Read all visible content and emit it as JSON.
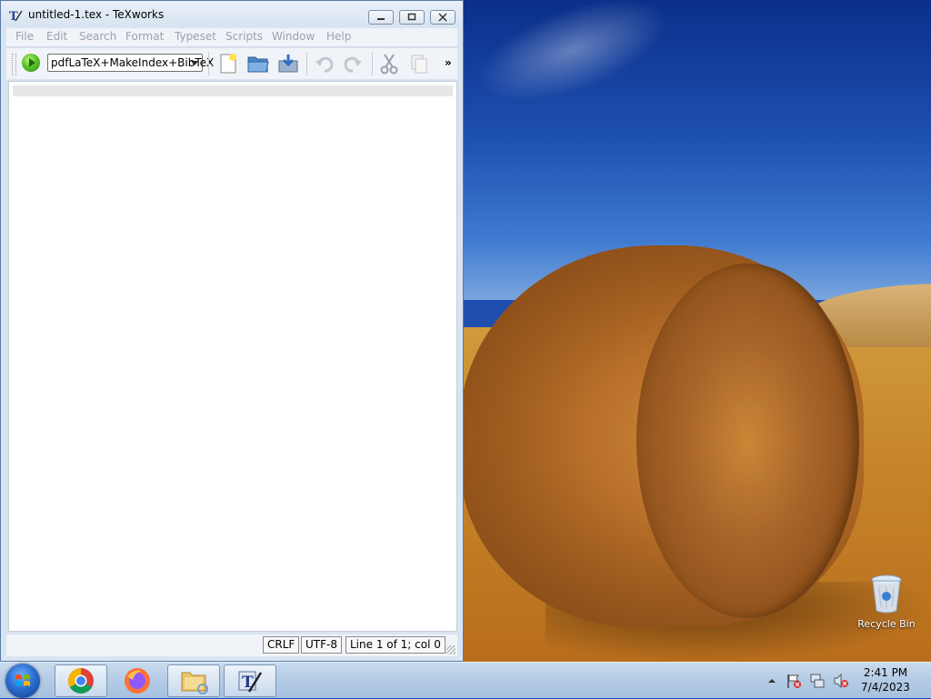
{
  "window": {
    "title": "untitled-1.tex - TeXworks",
    "controls": {
      "minimize": "minimize",
      "maximize": "maximize",
      "close": "close"
    }
  },
  "menubar": {
    "items": [
      "File",
      "Edit",
      "Search",
      "Format",
      "Typeset",
      "Scripts",
      "Window",
      "Help"
    ]
  },
  "toolbar": {
    "engine_value": "pdfLaTeX+MakeIndex+BibTeX",
    "more_label": "»",
    "icons": [
      "typeset-icon",
      "new-document-icon",
      "open-folder-icon",
      "save-icon",
      "undo-icon",
      "redo-icon",
      "cut-icon",
      "copy-icon"
    ]
  },
  "statusbar": {
    "line_ending": "CRLF",
    "encoding": "UTF-8",
    "position": "Line 1 of 1; col 0"
  },
  "desktop": {
    "recycle_bin_label": "Recycle Bin"
  },
  "taskbar": {
    "apps": [
      "start-orb-icon",
      "chrome-icon",
      "firefox-icon",
      "file-explorer-icon",
      "texworks-icon"
    ],
    "clock_time": "2:41 PM",
    "clock_date": "7/4/2023",
    "tray_icons": [
      "show-hidden-icons-arrow",
      "action-center-flag-icon",
      "network-icon",
      "volume-muted-icon"
    ]
  }
}
